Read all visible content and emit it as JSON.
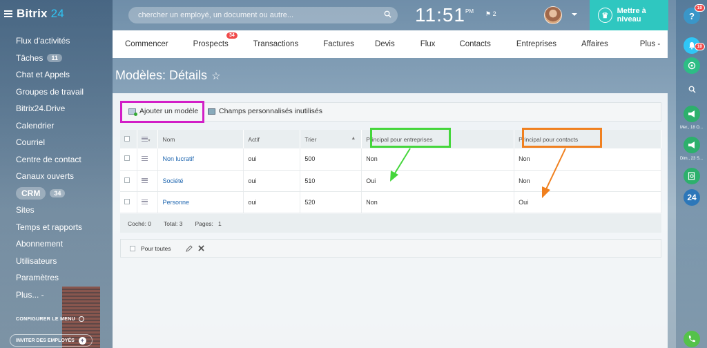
{
  "app": {
    "logo_text": "Bitrix",
    "logo_num": "24"
  },
  "sidebar": {
    "items": [
      {
        "label": "Flux d'activités"
      },
      {
        "label": "Tâches",
        "badge": "11"
      },
      {
        "label": "Chat et Appels"
      },
      {
        "label": "Groupes de travail"
      },
      {
        "label": "Bitrix24.Drive"
      },
      {
        "label": "Calendrier"
      },
      {
        "label": "Courriel"
      },
      {
        "label": "Centre de contact"
      },
      {
        "label": "Canaux ouverts"
      },
      {
        "label": "CRM",
        "badge": "34"
      },
      {
        "label": "Sites"
      },
      {
        "label": "Temps et rapports"
      },
      {
        "label": "Abonnement"
      },
      {
        "label": "Utilisateurs"
      },
      {
        "label": "Paramètres"
      },
      {
        "label": "Plus... -"
      }
    ],
    "configure_label": "CONFIGURER LE MENU",
    "invite_label": "INVITER DES EMPLOYÉS"
  },
  "topbar": {
    "search_placeholder": "chercher un employé, un document ou autre...",
    "time": "11:51",
    "ampm": "PM",
    "flag_count": "2",
    "upgrade_label": "Mettre à niveau"
  },
  "nav": {
    "tabs": [
      {
        "label": "Commencer"
      },
      {
        "label": "Prospects",
        "count": "34"
      },
      {
        "label": "Transactions"
      },
      {
        "label": "Factures"
      },
      {
        "label": "Devis"
      },
      {
        "label": "Flux"
      },
      {
        "label": "Contacts"
      },
      {
        "label": "Entreprises"
      },
      {
        "label": "Affaires"
      },
      {
        "label": "Plus -"
      }
    ]
  },
  "page": {
    "title": "Modèles: Détails",
    "star": "☆"
  },
  "toolbar": {
    "add_label": "Ajouter un modèle",
    "fields_label": "Champs personnalisés inutilisés"
  },
  "table": {
    "headers": {
      "name": "Nom",
      "active": "Actif",
      "sort": "Trier",
      "main_company": "Principal pour entreprises",
      "main_contact": "Principal pour contacts"
    },
    "rows": [
      {
        "name": "Non lucratif",
        "active": "oui",
        "sort": "500",
        "main_company": "Non",
        "main_contact": "Non"
      },
      {
        "name": "Société",
        "active": "oui",
        "sort": "510",
        "main_company": "Oui",
        "main_contact": "Non"
      },
      {
        "name": "Personne",
        "active": "oui",
        "sort": "520",
        "main_company": "Non",
        "main_contact": "Oui"
      }
    ],
    "footer": {
      "checked": "Coché: 0",
      "total": "Total: 3",
      "pages_label": "Pages:",
      "pages_value": "1"
    },
    "bulk_label": "Pour toutes"
  },
  "rightbar": {
    "help_label": "?",
    "help_badge": "10",
    "bell_badge": "10",
    "date1": "Mer., 18 O...",
    "date2": "Dim., 23 S...",
    "b24_label": "24"
  },
  "colors": {
    "highlight_add": "#d21fc7",
    "highlight_company": "#44d63b",
    "highlight_contact": "#f0801f",
    "upgrade_bg": "#2fc7c0",
    "link": "#2067b0"
  }
}
